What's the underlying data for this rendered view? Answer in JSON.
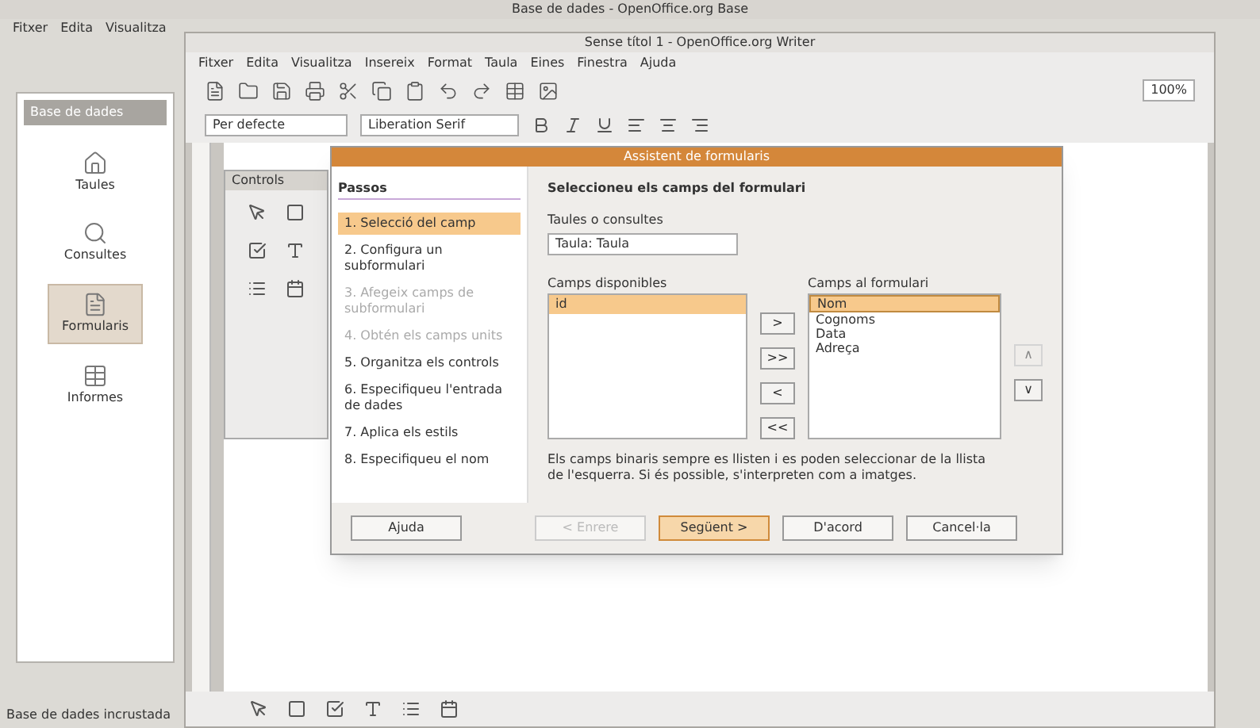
{
  "base_window": {
    "title": "Base de dades - OpenOffice.org Base",
    "menu": [
      "Fitxer",
      "Edita",
      "Visualitza"
    ],
    "sidebar": {
      "title": "Base de dades",
      "items": [
        {
          "label": "Taules",
          "selected": false
        },
        {
          "label": "Consultes",
          "selected": false
        },
        {
          "label": "Formularis",
          "selected": true
        },
        {
          "label": "Informes",
          "selected": false
        }
      ]
    },
    "status": "Base de dades incrustada"
  },
  "writer_window": {
    "title": "Sense títol 1 - OpenOffice.org Writer",
    "menu": [
      "Fitxer",
      "Edita",
      "Visualitza",
      "Insereix",
      "Format",
      "Taula",
      "Eines",
      "Finestra",
      "Ajuda"
    ],
    "style_box": "Per defecte",
    "font_box": "Liberation Serif",
    "zoom": "100%",
    "controls_title": "Controls"
  },
  "dialog": {
    "title": "Assistent de formularis",
    "steps_heading": "Passos",
    "steps": [
      {
        "label": "1. Selecció del camp",
        "selected": true,
        "disabled": false
      },
      {
        "label": "2. Configura un subformulari",
        "selected": false,
        "disabled": false
      },
      {
        "label": "3. Afegeix camps de subformulari",
        "selected": false,
        "disabled": true
      },
      {
        "label": "4. Obtén els camps units",
        "selected": false,
        "disabled": true
      },
      {
        "label": "5. Organitza els controls",
        "selected": false,
        "disabled": false
      },
      {
        "label": "6. Especifiqueu l'entrada de dades",
        "selected": false,
        "disabled": false
      },
      {
        "label": "7. Aplica els estils",
        "selected": false,
        "disabled": false
      },
      {
        "label": "8. Especifiqueu el nom",
        "selected": false,
        "disabled": false
      }
    ],
    "heading": "Seleccioneu els camps del formulari",
    "tables_label": "Taules o consultes",
    "table_value": "Taula: Taula",
    "available_label": "Camps disponibles",
    "available": [
      {
        "label": "id",
        "selected": true
      }
    ],
    "form_label": "Camps al formulari",
    "form_fields": [
      {
        "label": "Nom",
        "selected": true
      },
      {
        "label": "Cognoms",
        "selected": false
      },
      {
        "label": "Data",
        "selected": false
      },
      {
        "label": "Adreça",
        "selected": false
      }
    ],
    "move_buttons": [
      ">",
      ">>",
      "<",
      "<<"
    ],
    "order_buttons": [
      {
        "label": "∧",
        "disabled": true
      },
      {
        "label": "∨",
        "disabled": false
      }
    ],
    "note": "Els camps binaris sempre es llisten i es poden seleccionar de la llista de l'esquerra. Si és possible, s'interpreten com a imatges.",
    "buttons": [
      {
        "label": "Ajuda",
        "disabled": false,
        "default": false
      },
      {
        "label": "< Enrere",
        "disabled": true,
        "default": false
      },
      {
        "label": "Següent >",
        "disabled": false,
        "default": true
      },
      {
        "label": "D'acord",
        "disabled": false,
        "default": false
      },
      {
        "label": "Cancel·la",
        "disabled": false,
        "default": false
      }
    ]
  }
}
